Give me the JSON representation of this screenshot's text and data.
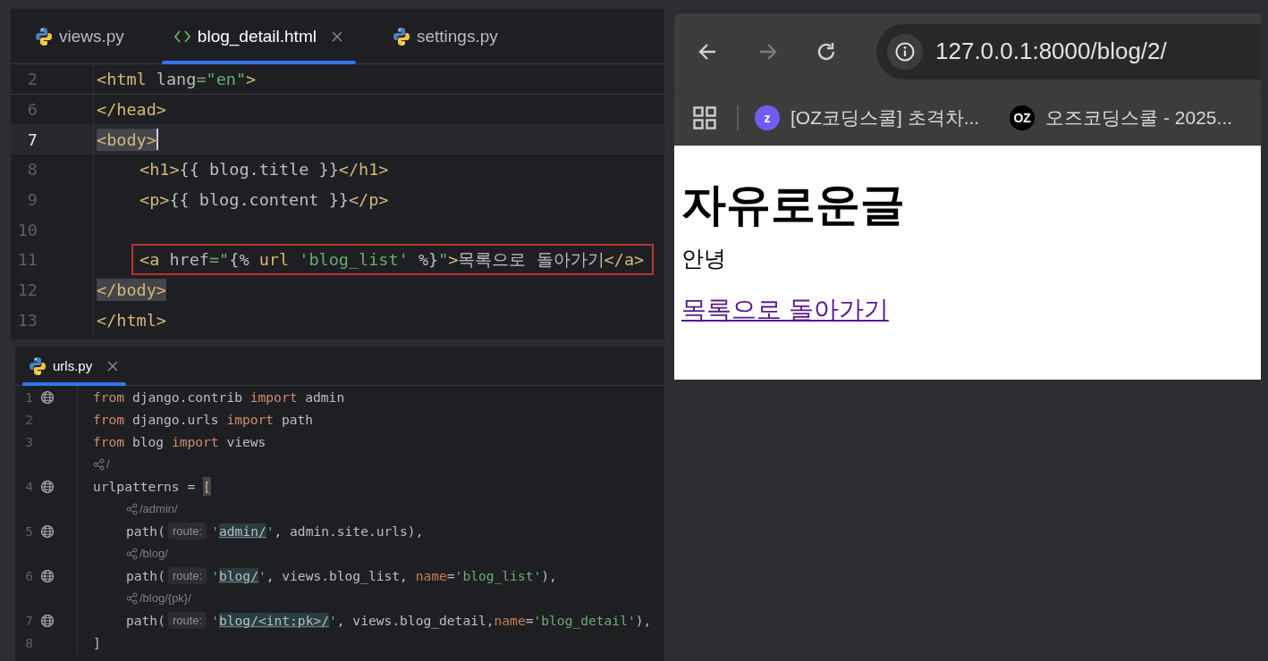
{
  "editors": [
    {
      "tabs": [
        {
          "label": "views.py",
          "kind": "python",
          "selected": false,
          "closable": false
        },
        {
          "label": "blog_detail.html",
          "kind": "html",
          "selected": true,
          "closable": true
        },
        {
          "label": "settings.py",
          "kind": "python",
          "selected": false,
          "closable": false
        }
      ],
      "lines": [
        {
          "kind": "code",
          "number": "2",
          "sticky": true,
          "current": false,
          "caret": false,
          "indented": false,
          "globe": false,
          "segments": [
            {
              "kind": "tag",
              "text": "<html"
            },
            {
              "kind": "attr",
              "text": " lang"
            },
            {
              "kind": "str",
              "text": "=\"en\""
            },
            {
              "kind": "tag",
              "text": ">"
            }
          ]
        },
        {
          "kind": "code",
          "number": "6",
          "sticky": false,
          "current": false,
          "caret": false,
          "indented": false,
          "globe": false,
          "segments": [
            {
              "kind": "tag",
              "text": "</head>"
            }
          ]
        },
        {
          "kind": "code",
          "number": "7",
          "sticky": false,
          "current": true,
          "caret": true,
          "indented": false,
          "globe": false,
          "segments": [
            {
              "kind": "match",
              "text": "<body>"
            }
          ]
        },
        {
          "kind": "code",
          "number": "8",
          "sticky": false,
          "current": false,
          "caret": false,
          "indented": true,
          "globe": false,
          "segments": [
            {
              "kind": "tag",
              "text": "<h1>"
            },
            {
              "kind": "text",
              "text": "{{ blog.title }}"
            },
            {
              "kind": "tag",
              "text": "</h1>"
            }
          ]
        },
        {
          "kind": "code",
          "number": "9",
          "sticky": false,
          "current": false,
          "caret": false,
          "indented": true,
          "globe": false,
          "segments": [
            {
              "kind": "tag",
              "text": "<p>"
            },
            {
              "kind": "text",
              "text": "{{ blog.content }}"
            },
            {
              "kind": "tag",
              "text": "</p>"
            }
          ]
        },
        {
          "kind": "code",
          "number": "10",
          "sticky": false,
          "current": false,
          "caret": false,
          "indented": false,
          "globe": false
        },
        {
          "kind": "code",
          "number": "11",
          "sticky": false,
          "current": false,
          "caret": false,
          "indented": true,
          "globe": false,
          "boxed": true,
          "segments": [
            {
              "kind": "tag",
              "text": "<a"
            },
            {
              "kind": "attr",
              "text": " href"
            },
            {
              "kind": "str",
              "text": "=\""
            },
            {
              "kind": "text",
              "text": "{%"
            },
            {
              "kind": "tag",
              "text": " url"
            },
            {
              "kind": "str",
              "text": " 'blog_list'"
            },
            {
              "kind": "text",
              "text": " %}"
            },
            {
              "kind": "str",
              "text": "\""
            },
            {
              "kind": "tag",
              "text": ">"
            },
            {
              "kind": "text",
              "text": "목록으로 돌아가기"
            },
            {
              "kind": "tag",
              "text": "</a>"
            }
          ]
        },
        {
          "kind": "code",
          "number": "12",
          "sticky": false,
          "current": false,
          "caret": false,
          "indented": false,
          "globe": false,
          "segments": [
            {
              "kind": "match",
              "text": "</body>"
            }
          ]
        },
        {
          "kind": "code",
          "number": "13",
          "sticky": false,
          "current": false,
          "caret": false,
          "indented": false,
          "globe": false,
          "segments": [
            {
              "kind": "tag",
              "text": "</html>"
            }
          ]
        }
      ]
    },
    {
      "tabs": [
        {
          "label": "urls.py",
          "kind": "python",
          "selected": true,
          "closable": true
        }
      ],
      "lines": [
        {
          "kind": "code",
          "number": "1",
          "sticky": false,
          "current": false,
          "caret": false,
          "indented": false,
          "globe": true,
          "segments": [
            {
              "kind": "kw",
              "text": "from"
            },
            {
              "kind": "text",
              "text": " django.contrib "
            },
            {
              "kind": "kw",
              "text": "import"
            },
            {
              "kind": "text",
              "text": " admin"
            }
          ]
        },
        {
          "kind": "code",
          "number": "2",
          "sticky": false,
          "current": false,
          "caret": false,
          "indented": false,
          "globe": false,
          "segments": [
            {
              "kind": "kw",
              "text": "from"
            },
            {
              "kind": "text",
              "text": " django.urls "
            },
            {
              "kind": "kw",
              "text": "import"
            },
            {
              "kind": "text",
              "text": " path"
            }
          ]
        },
        {
          "kind": "code",
          "number": "3",
          "sticky": false,
          "current": false,
          "caret": false,
          "indented": false,
          "globe": false,
          "segments": [
            {
              "kind": "kw",
              "text": "from"
            },
            {
              "kind": "text",
              "text": " blog "
            },
            {
              "kind": "kw",
              "text": "import"
            },
            {
              "kind": "text",
              "text": " views"
            }
          ]
        },
        {
          "kind": "usage",
          "indented": false,
          "text": "/"
        },
        {
          "kind": "code",
          "number": "4",
          "sticky": false,
          "current": false,
          "caret": false,
          "indented": false,
          "globe": true,
          "segments": [
            {
              "kind": "text",
              "text": "urlpatterns = "
            },
            {
              "kind": "match",
              "text": "["
            }
          ]
        },
        {
          "kind": "usage",
          "indented": true,
          "text": "/admin/"
        },
        {
          "kind": "code",
          "number": "5",
          "sticky": false,
          "current": false,
          "caret": false,
          "indented": true,
          "globe": true,
          "segments": [
            {
              "kind": "text",
              "text": "path("
            },
            {
              "kind": "inlay",
              "text": "route:"
            },
            {
              "kind": "str",
              "text": "'"
            },
            {
              "kind": "route",
              "text": "admin/"
            },
            {
              "kind": "str",
              "text": "'"
            },
            {
              "kind": "text",
              "text": ", admin.site.urls),"
            }
          ]
        },
        {
          "kind": "usage",
          "indented": true,
          "text": "/blog/"
        },
        {
          "kind": "code",
          "number": "6",
          "sticky": false,
          "current": false,
          "caret": false,
          "indented": true,
          "globe": true,
          "segments": [
            {
              "kind": "text",
              "text": "path("
            },
            {
              "kind": "inlay",
              "text": "route:"
            },
            {
              "kind": "str",
              "text": "'"
            },
            {
              "kind": "route",
              "text": "blog/"
            },
            {
              "kind": "str",
              "text": "'"
            },
            {
              "kind": "text",
              "text": ", views.blog_list, "
            },
            {
              "kind": "param",
              "text": "name"
            },
            {
              "kind": "text",
              "text": "="
            },
            {
              "kind": "str",
              "text": "'blog_list'"
            },
            {
              "kind": "text",
              "text": "),"
            }
          ]
        },
        {
          "kind": "usage",
          "indented": true,
          "text": "/blog/{pk}/"
        },
        {
          "kind": "code",
          "number": "7",
          "sticky": false,
          "current": false,
          "caret": false,
          "indented": true,
          "globe": true,
          "segments": [
            {
              "kind": "text",
              "text": "path("
            },
            {
              "kind": "inlay",
              "text": "route:"
            },
            {
              "kind": "str",
              "text": "'"
            },
            {
              "kind": "route",
              "text": "blog/<int:pk>/"
            },
            {
              "kind": "str",
              "text": "'"
            },
            {
              "kind": "text",
              "text": ", views.blog_detail,"
            },
            {
              "kind": "param",
              "text": "name"
            },
            {
              "kind": "text",
              "text": "="
            },
            {
              "kind": "str",
              "text": "'blog_detail'"
            },
            {
              "kind": "text",
              "text": "),"
            }
          ]
        },
        {
          "kind": "code",
          "number": "8",
          "sticky": false,
          "current": false,
          "caret": false,
          "indented": false,
          "globe": false,
          "segments": [
            {
              "kind": "text",
              "text": "]"
            }
          ]
        }
      ]
    }
  ],
  "browser": {
    "back_disabled": false,
    "forward_disabled": true,
    "url": "127.0.0.1:8000/blog/2/",
    "bookmarks": [
      {
        "label": "[OZ코딩스쿨] 초격차...",
        "icon_text": "z",
        "color": "#6f5cf0"
      },
      {
        "label": "오즈코딩스쿨 - 2025...",
        "icon_text": "OZ",
        "color": "#000000"
      }
    ],
    "page": {
      "heading": "자유로운글",
      "paragraph": "안녕",
      "link": "목록으로 돌아가기"
    }
  }
}
